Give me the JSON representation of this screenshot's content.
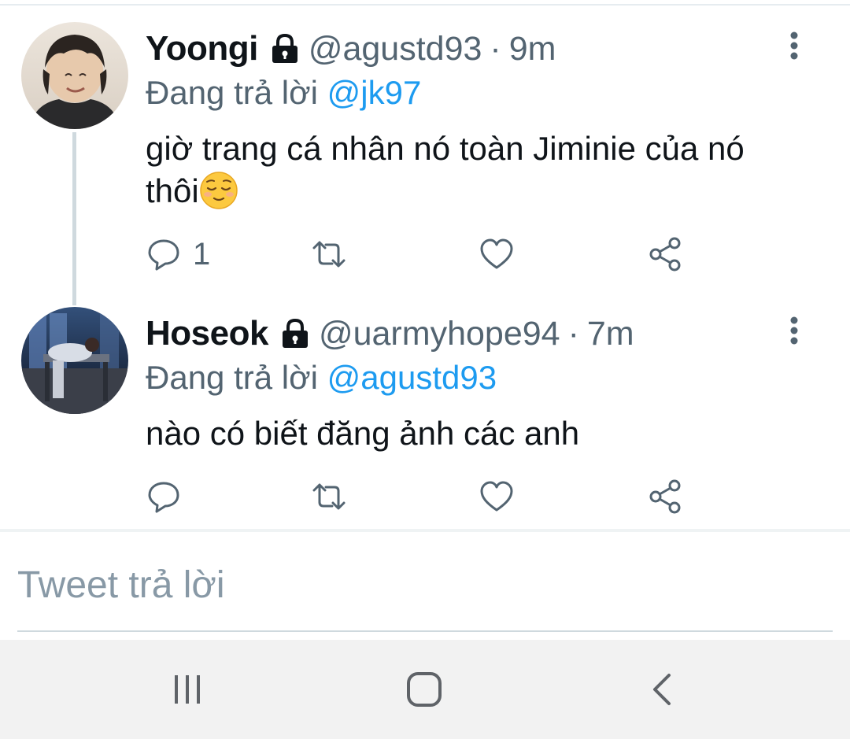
{
  "tweets": [
    {
      "display_name": "Yoongi",
      "handle": "@agustd93",
      "separator": "·",
      "time": "9m",
      "reply_prefix": "Đang trả lời",
      "reply_mention": "@jk97",
      "text_main": "giờ trang cá nhân nó toàn Jiminie của nó thôi",
      "text_emoji": "relieved-face-emoji",
      "reply_count": "1",
      "avatar": "profile-photo-yoongi"
    },
    {
      "display_name": "Hoseok",
      "handle": "@uarmyhope94",
      "separator": "·",
      "time": "7m",
      "reply_prefix": "Đang trả lời",
      "reply_mention": "@agustd93",
      "text_main": "nào có biết đăng ảnh các anh",
      "reply_count": "",
      "avatar": "profile-photo-hoseok"
    }
  ],
  "reply_box": {
    "placeholder": "Tweet trả lời"
  },
  "icons": {
    "lock": "lock-icon",
    "more": "more-vertical-icon",
    "reply": "comment-icon",
    "retweet": "retweet-icon",
    "like": "heart-icon",
    "share": "share-icon"
  },
  "navbar": {
    "recents": "recent-apps-icon",
    "home": "home-icon",
    "back": "back-icon"
  },
  "colors": {
    "link": "#1d9bf0",
    "secondary_text": "#536471",
    "primary_text": "#0f1419",
    "divider": "#e6ecf0",
    "navbar_bg": "#f2f2f2"
  }
}
